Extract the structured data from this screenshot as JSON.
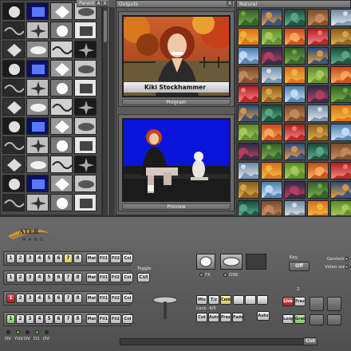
{
  "panes": {
    "parent": {
      "title": "Parent",
      "close": "X",
      "pin": "A"
    },
    "outputs": {
      "title": "Outputs",
      "close": "X"
    },
    "natural": {
      "title": "Natural"
    }
  },
  "program": {
    "caption_name": "Kiki Stockhammer",
    "label": "Program"
  },
  "preview": {
    "label": "Preview"
  },
  "console": {
    "logo_text": "ATER",
    "logo_sub": "M A N D",
    "rows": [
      {
        "nums": [
          "1",
          "2",
          "3",
          "4",
          "5",
          "6",
          "7",
          "8"
        ],
        "aux": [
          "Mat",
          "Fil1",
          "Fil2",
          "Col"
        ]
      },
      {
        "nums": [
          "1",
          "2",
          "3",
          "4",
          "5",
          "6",
          "7",
          "8"
        ],
        "aux": [
          "Mat",
          "Fil1",
          "Fil2",
          "Col"
        ]
      },
      {
        "nums": [
          "1",
          "2",
          "3",
          "4",
          "5",
          "6",
          "7",
          "8"
        ],
        "aux": [
          "Mat",
          "Fil1",
          "Fil2",
          "Col"
        ]
      },
      {
        "nums": [
          "1",
          "2",
          "3",
          "4",
          "5",
          "6",
          "7",
          "8"
        ],
        "aux": [
          "Mat",
          "Fil1",
          "Fil2",
          "Col"
        ]
      }
    ],
    "inputs": [
      "DV",
      "YUV",
      "DV",
      "D1",
      "DV"
    ],
    "toggle_label": "Toggle",
    "cut_label": "Cut",
    "fx_label": "FX",
    "dsk_label": "DSK",
    "key_label": "Key",
    "key_value": "Off",
    "genlock_label": "Genlock",
    "videoout_label": "Video out",
    "mix_buttons": [
      "Mix",
      "T/z",
      "Cmk"
    ],
    "lock_label": "Lock",
    "lock_value": "4/5",
    "cut_buttons": [
      "Cut",
      "Auto",
      "Frez",
      "Fade"
    ],
    "auto_label": "Auto",
    "auto_sub": "Rdy",
    "live_label": "Live",
    "live_buttons": [
      "Live",
      "Frez",
      "Loop",
      "Grab"
    ],
    "counter_top": "2",
    "counter_bottom": "2",
    "cmd_label": "Cut",
    "highlight_color": "#d8c25a",
    "accent_red": "#b02a2a",
    "accent_green": "#86c266"
  }
}
